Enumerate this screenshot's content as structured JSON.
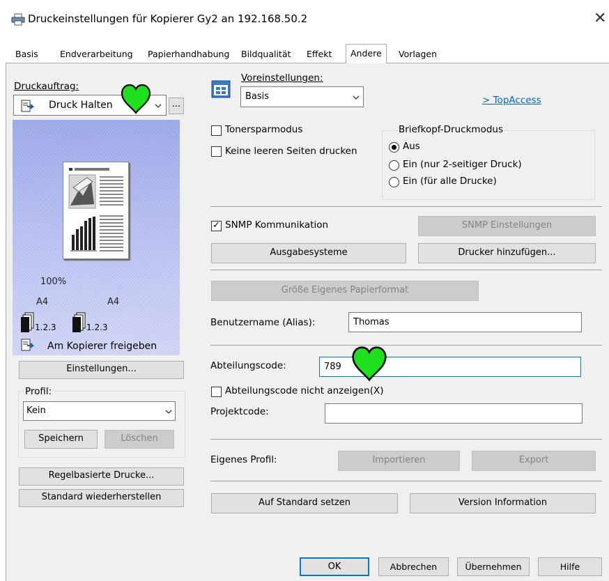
{
  "window": {
    "title": "Druckeinstellungen für Kopierer Gy2 an 192.168.50.2"
  },
  "tabs": [
    "Basis",
    "Endverarbeitung",
    "Papierhandhabung",
    "Bildqualität",
    "Effekt",
    "Andere",
    "Vorlagen"
  ],
  "selected_tab": "Andere",
  "left": {
    "druckauftrag_label": "Druckauftrag:",
    "druckauftrag_value": "Druck Halten",
    "more_button": "...",
    "preview": {
      "zoom": "100%",
      "paper_left": "A4",
      "paper_right": "A4",
      "copies_left": "1.2.3",
      "copies_right": "1.2.3",
      "release_text": "Am Kopierer freigeben"
    },
    "einstellungen_button": "Einstellungen...",
    "profil_label": "Profil:",
    "profil_value": "Kein",
    "speichern_button": "Speichern",
    "loeschen_button": "Löschen",
    "regelbasierte_button": "Regelbasierte Drucke...",
    "standard_wiederherstellen_button": "Standard wiederherstellen"
  },
  "right": {
    "voreinstellungen_label": "Voreinstellungen:",
    "voreinstellungen_value": "Basis",
    "topaccess_link": "> TopAccess",
    "tonersparmodus": "Tonersparmodus",
    "keine_leeren": "Keine leeren Seiten drucken",
    "briefkopf_label": "Briefkopf-Druckmodus",
    "briefkopf_options": [
      "Aus",
      "Ein (nur 2-seitiger Druck)",
      "Ein (für alle Drucke)"
    ],
    "snmp_checkbox": "SNMP Kommunikation",
    "snmp_button": "SNMP Einstellungen",
    "ausgabesysteme_button": "Ausgabesysteme",
    "drucker_hinzufuegen_button": "Drucker hinzufügen...",
    "groesse_button": "Größe Eigenes Papierformat",
    "benutzername_label": "Benutzername (Alias):",
    "benutzername_value": "Thomas",
    "abteilungscode_label": "Abteilungscode:",
    "abteilungscode_value": "789",
    "abteilungscode_nicht_anzeigen": "Abteilungscode nicht anzeigen(X)",
    "projektcode_label": "Projektcode:",
    "projektcode_value": "",
    "eigenes_profil_label": "Eigenes Profil:",
    "importieren_button": "Importieren",
    "export_button": "Export",
    "auf_standard_button": "Auf Standard setzen",
    "version_button": "Version Information"
  },
  "footer": {
    "ok": "OK",
    "abbrechen": "Abbrechen",
    "uebernehmen": "Übernehmen",
    "hilfe": "Hilfe"
  },
  "colors": {
    "accent": "#0078d7",
    "heart": "#1ee01e"
  }
}
